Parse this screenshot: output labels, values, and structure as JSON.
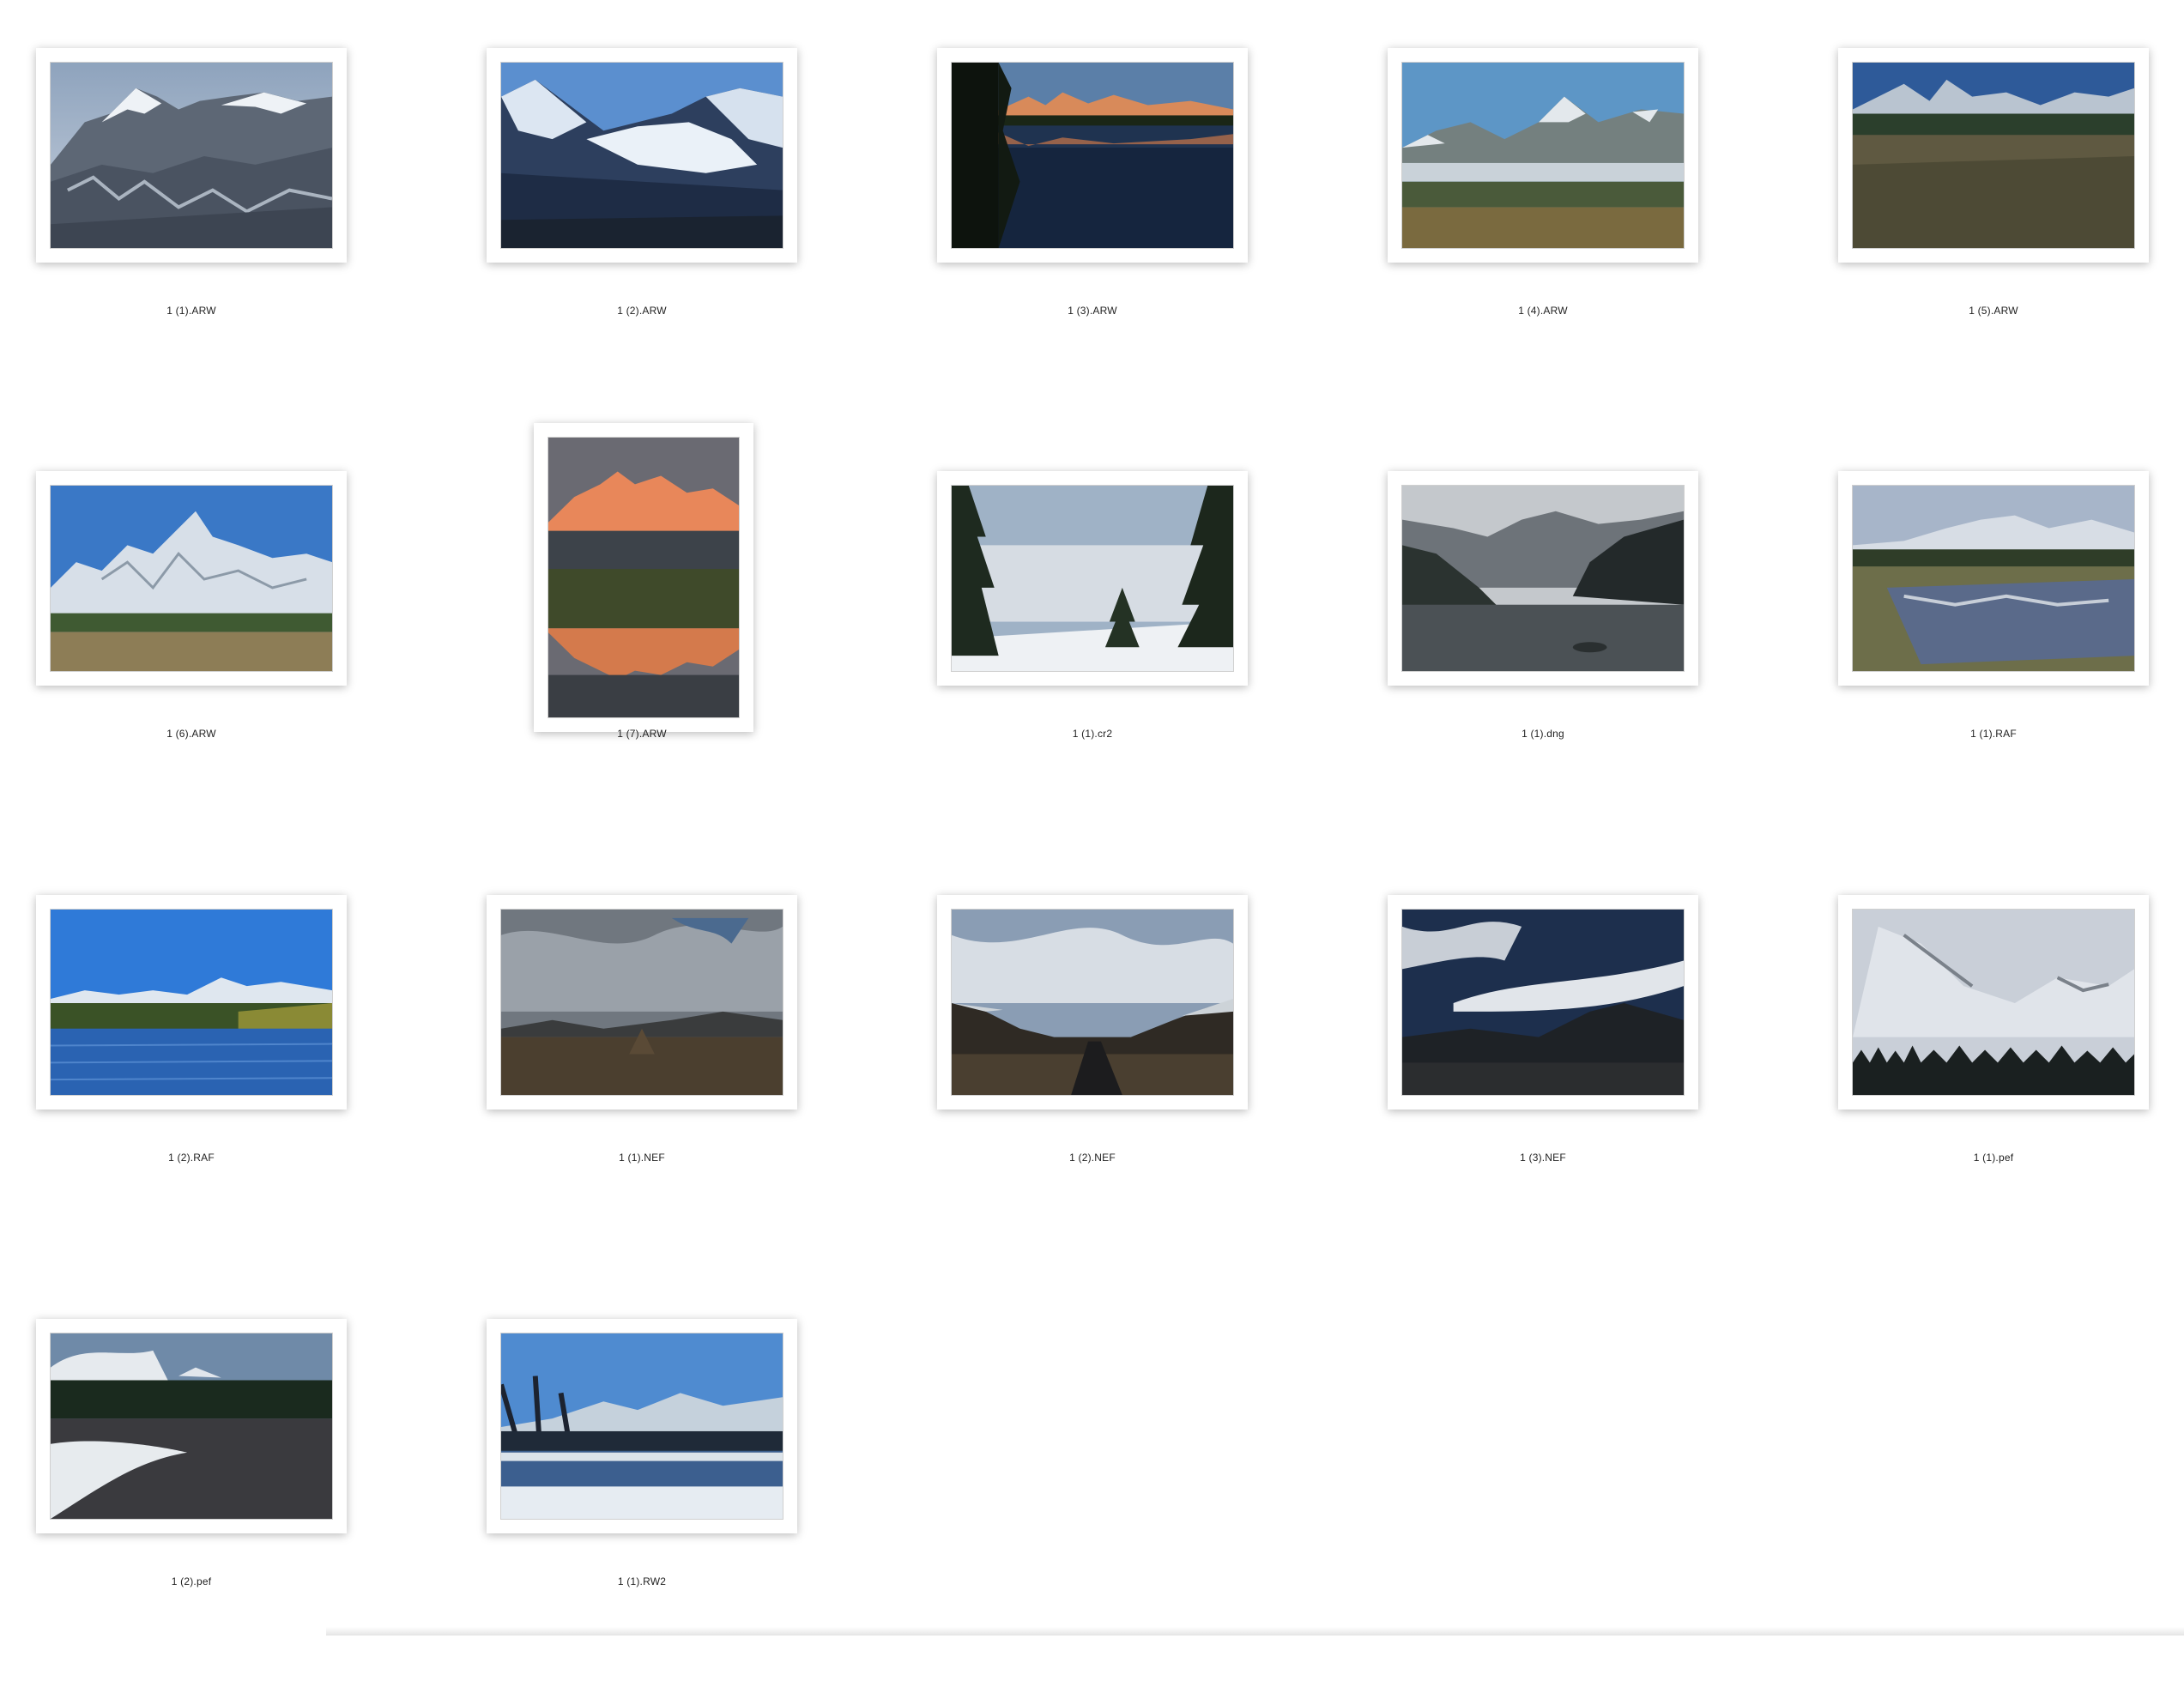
{
  "gallery": {
    "items": [
      {
        "filename": "1 (1).ARW",
        "orientation": "landscape",
        "scene": "snow-capped-rocky-peaks"
      },
      {
        "filename": "1 (2).ARW",
        "orientation": "landscape",
        "scene": "glacier-valley"
      },
      {
        "filename": "1 (3).ARW",
        "orientation": "landscape",
        "scene": "sunrise-peaks-reflection"
      },
      {
        "filename": "1 (4).ARW",
        "orientation": "landscape",
        "scene": "peak-above-fog-plain"
      },
      {
        "filename": "1 (5).ARW",
        "orientation": "landscape",
        "scene": "tetons-sagebrush"
      },
      {
        "filename": "1 (6).ARW",
        "orientation": "landscape",
        "scene": "tetons-blue-sky"
      },
      {
        "filename": "1 (7).ARW",
        "orientation": "portrait",
        "scene": "alpenglow-reflection"
      },
      {
        "filename": "1 (1).cr2",
        "orientation": "landscape",
        "scene": "pines-snowy-plain"
      },
      {
        "filename": "1 (1).dng",
        "orientation": "landscape",
        "scene": "dark-fjord-lake"
      },
      {
        "filename": "1 (1).RAF",
        "orientation": "landscape",
        "scene": "tetons-pond-reflection"
      },
      {
        "filename": "1 (2).RAF",
        "orientation": "landscape",
        "scene": "blue-lake-mountains"
      },
      {
        "filename": "1 (1).NEF",
        "orientation": "landscape",
        "scene": "cloudy-sky-hut"
      },
      {
        "filename": "1 (2).NEF",
        "orientation": "landscape",
        "scene": "road-under-clouds"
      },
      {
        "filename": "1 (3).NEF",
        "orientation": "landscape",
        "scene": "dramatic-clouds-valley"
      },
      {
        "filename": "1 (1).pef",
        "orientation": "landscape",
        "scene": "misty-mountain-forest"
      },
      {
        "filename": "1 (2).pef",
        "orientation": "landscape",
        "scene": "lake-snow-shore"
      },
      {
        "filename": "1 (1).RW2",
        "orientation": "landscape",
        "scene": "winter-river-mountains"
      }
    ]
  }
}
